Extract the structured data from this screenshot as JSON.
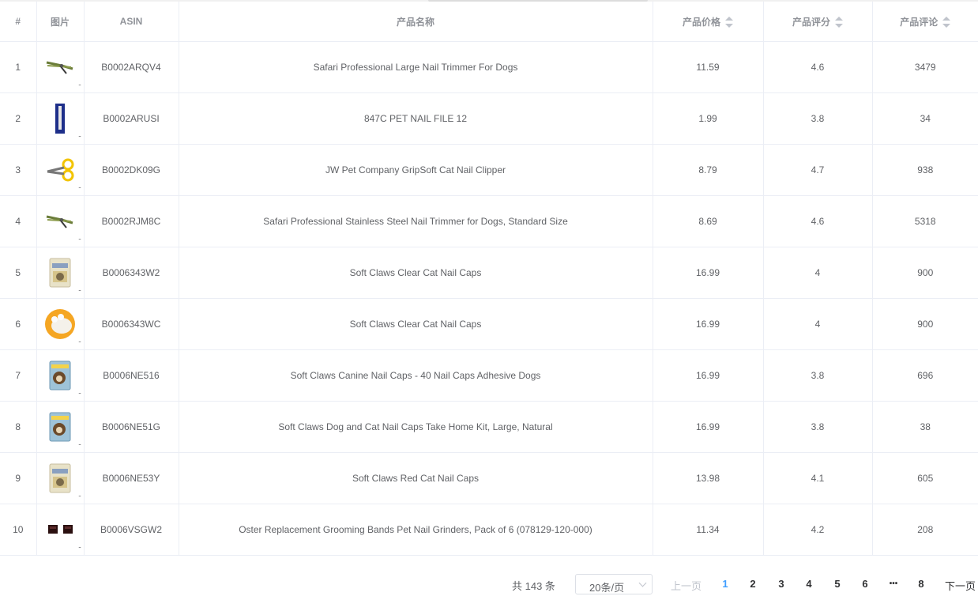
{
  "table": {
    "columns": {
      "index": "#",
      "image": "图片",
      "asin": "ASIN",
      "name": "产品名称",
      "price": "产品价格",
      "rating": "产品评分",
      "reviews": "产品评论"
    },
    "rows": [
      {
        "index": "1",
        "asin": "B0002ARQV4",
        "name": "Safari Professional Large Nail Trimmer For Dogs",
        "price": "11.59",
        "rating": "4.6",
        "reviews": "3479",
        "thumb": "clipper-icon",
        "more": ".."
      },
      {
        "index": "2",
        "asin": "B0002ARUSI",
        "name": "847C PET NAIL FILE 12",
        "price": "1.99",
        "rating": "3.8",
        "reviews": "34",
        "thumb": "nail-file-icon",
        "more": ".."
      },
      {
        "index": "3",
        "asin": "B0002DK09G",
        "name": "JW Pet Company GripSoft Cat Nail Clipper",
        "price": "8.79",
        "rating": "4.7",
        "reviews": "938",
        "thumb": "scissors-clipper-icon",
        "more": ".."
      },
      {
        "index": "4",
        "asin": "B0002RJM8C",
        "name": "Safari Professional Stainless Steel Nail Trimmer for Dogs, Standard Size",
        "price": "8.69",
        "rating": "4.6",
        "reviews": "5318",
        "thumb": "clipper-icon",
        "more": ".."
      },
      {
        "index": "5",
        "asin": "B0006343W2",
        "name": "Soft Claws Clear Cat Nail Caps",
        "price": "16.99",
        "rating": "4",
        "reviews": "900",
        "thumb": "package-icon",
        "more": ".."
      },
      {
        "index": "6",
        "asin": "B0006343WC",
        "name": "Soft Claws Clear Cat Nail Caps",
        "price": "16.99",
        "rating": "4",
        "reviews": "900",
        "thumb": "cat-paw-icon",
        "more": ".."
      },
      {
        "index": "7",
        "asin": "B0006NE516",
        "name": "Soft Claws Canine Nail Caps - 40 Nail Caps Adhesive Dogs",
        "price": "16.99",
        "rating": "3.8",
        "reviews": "696",
        "thumb": "dog-package-icon",
        "more": ".."
      },
      {
        "index": "8",
        "asin": "B0006NE51G",
        "name": "Soft Claws Dog and Cat Nail Caps Take Home Kit, Large, Natural",
        "price": "16.99",
        "rating": "3.8",
        "reviews": "38",
        "thumb": "dog-package-icon",
        "more": ".."
      },
      {
        "index": "9",
        "asin": "B0006NE53Y",
        "name": "Soft Claws Red Cat Nail Caps",
        "price": "13.98",
        "rating": "4.1",
        "reviews": "605",
        "thumb": "package-icon",
        "more": ".."
      },
      {
        "index": "10",
        "asin": "B0006VSGW2",
        "name": "Oster Replacement Grooming Bands Pet Nail Grinders, Pack of 6 (078129-120-000)",
        "price": "11.34",
        "rating": "4.2",
        "reviews": "208",
        "thumb": "grinding-bands-icon",
        "more": ".."
      }
    ]
  },
  "pagination": {
    "total_text": "共 143 条",
    "page_size": "20条/页",
    "prev": "上一页",
    "next": "下一页",
    "pages": [
      "1",
      "2",
      "3",
      "4",
      "5",
      "6"
    ],
    "ellipsis": "•••",
    "last_page": "8",
    "current_page": "1",
    "active_color": "#409eff"
  }
}
